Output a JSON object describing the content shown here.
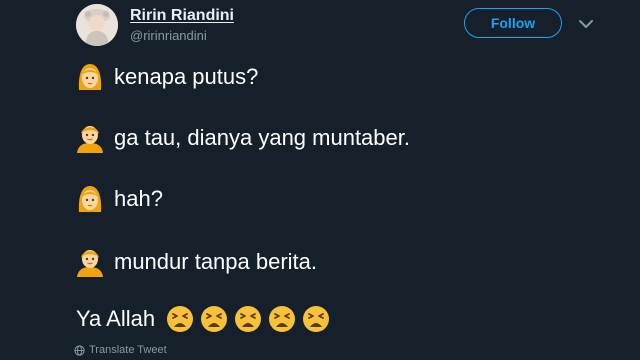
{
  "user": {
    "display_name": "Ririn Riandini",
    "handle": "@ririnriandini"
  },
  "follow_label": "Follow",
  "tweet_lines": [
    {
      "speaker": "woman-icon",
      "text": "kenapa putus?"
    },
    {
      "speaker": "person-icon",
      "text": "ga tau, dianya yang muntaber."
    },
    {
      "speaker": "woman-icon",
      "text": "hah?"
    },
    {
      "speaker": "person-icon",
      "text": "mundur tanpa berita."
    }
  ],
  "closing": {
    "text": "Ya Allah",
    "emoji": "tired-face-icon",
    "emoji_count": 5
  },
  "translate_label": "Translate Tweet",
  "colors": {
    "background": "#15202b",
    "accent": "#1da1f2",
    "muted": "#8899a6",
    "text": "#ffffff"
  }
}
